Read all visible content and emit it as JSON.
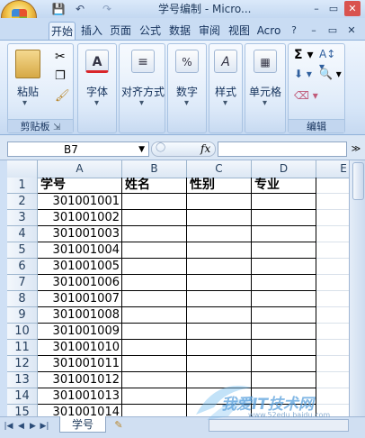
{
  "title_bar": {
    "title": "学号编制 - Micro...",
    "minimize": "–",
    "restore": "▭",
    "close": "✕"
  },
  "quick_access": {
    "save": "💾",
    "undo": "↶",
    "redo": "↷"
  },
  "tabs": [
    {
      "label": "开始"
    },
    {
      "label": "插入"
    },
    {
      "label": "页面"
    },
    {
      "label": "公式"
    },
    {
      "label": "数据"
    },
    {
      "label": "审阅"
    },
    {
      "label": "视图"
    },
    {
      "label": "Acro"
    }
  ],
  "ribbon": {
    "help": "?",
    "min": "–",
    "restore": "▭",
    "close": "✕",
    "clipboard": {
      "paste": "粘贴",
      "group_label": "剪贴板"
    },
    "font": {
      "label": "字体"
    },
    "alignment": {
      "label": "对齐方式"
    },
    "number": {
      "label": "数字"
    },
    "style": {
      "label": "样式"
    },
    "cells": {
      "label": "单元格"
    },
    "editing": {
      "group_label": "编辑"
    }
  },
  "formula_bar": {
    "name_box": "B7",
    "fx": "fx",
    "value": ""
  },
  "columns": [
    "A",
    "B",
    "C",
    "D",
    "E"
  ],
  "rows": [
    {
      "n": "1",
      "a": "学号",
      "b": "姓名",
      "c": "性别",
      "d": "专业"
    },
    {
      "n": "2",
      "a": "301001001"
    },
    {
      "n": "3",
      "a": "301001002"
    },
    {
      "n": "4",
      "a": "301001003"
    },
    {
      "n": "5",
      "a": "301001004"
    },
    {
      "n": "6",
      "a": "301001005"
    },
    {
      "n": "7",
      "a": "301001006"
    },
    {
      "n": "8",
      "a": "301001007"
    },
    {
      "n": "9",
      "a": "301001008"
    },
    {
      "n": "10",
      "a": "301001009"
    },
    {
      "n": "11",
      "a": "301001010"
    },
    {
      "n": "12",
      "a": "301001011"
    },
    {
      "n": "13",
      "a": "301001012"
    },
    {
      "n": "14",
      "a": "301001013"
    },
    {
      "n": "15",
      "a": "301001014"
    }
  ],
  "sheet_tabs": {
    "active": "学号"
  },
  "watermark": {
    "text": "我爱IT技术网",
    "url": "www.52edu.baidu.com"
  },
  "colors": {
    "accent": "#c3d8f1",
    "grid_border": "#000000"
  }
}
